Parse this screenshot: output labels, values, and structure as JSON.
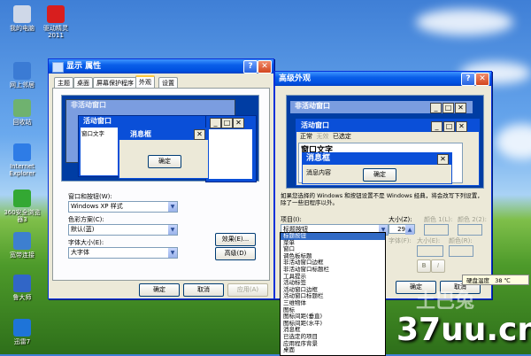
{
  "desktop_icons": [
    {
      "label": "我的电脑",
      "color": "#cfd8e8"
    },
    {
      "label": "驱动精灵\n2011",
      "color": "#d81e1e"
    },
    {
      "label": "网上邻居",
      "color": "#3b7bd4"
    },
    {
      "label": "回收站",
      "color": "#6fb26f"
    },
    {
      "label": "Internet\nExplorer",
      "color": "#2e7ce6"
    },
    {
      "label": "360安全浏览\n器3",
      "color": "#33a833"
    },
    {
      "label": "宽带连接",
      "color": "#3d7fd0"
    },
    {
      "label": "鲁大师",
      "color": "#3166c7"
    },
    {
      "label": "迅雷7",
      "color": "#1e74d8"
    }
  ],
  "display_window": {
    "title": "显示 属性",
    "tabs": [
      "主题",
      "桌面",
      "屏幕保护程序",
      "外观",
      "设置"
    ],
    "active_tab": 3,
    "preview": {
      "inactive_title": "非活动窗口",
      "active_title": "活动窗口",
      "window_text": "窗口文字",
      "msgbox_title": "消息框",
      "ok_label": "确定"
    },
    "style_label": "窗口和按钮(W):",
    "style_value": "Windows XP 样式",
    "color_label": "色彩方案(C):",
    "color_value": "默认(蓝)",
    "font_label": "字体大小(E):",
    "font_value": "大字体",
    "effects_button": "效果(E)...",
    "advanced_button": "高级(D)",
    "ok_button": "确定",
    "cancel_button": "取消",
    "apply_button": "应用(A)"
  },
  "advanced_window": {
    "title": "高级外观",
    "preview": {
      "inactive_title": "非活动窗口",
      "active_title": "活动窗口",
      "menu_items": [
        "正常",
        "无效",
        "已选定"
      ],
      "window_text": "窗口文字",
      "msgbox_title": "消息框",
      "msg_content": "消息内容",
      "ok_label": "确定"
    },
    "description": "如果您选择的 Windows 和按钮设置不是 Windows 经典，将会改写下列设置，除了一些旧程序以外。",
    "item_label": "项目(I):",
    "item_value": "标题按钮",
    "size_label": "大小(Z):",
    "size_value": "29",
    "color1_label": "颜色 1(L):",
    "color2_label": "颜色 2(2):",
    "font_label": "字体(F):",
    "font_size_label": "大小(E):",
    "font_color_label": "颜色(R):",
    "list_items": [
      "标题按钮",
      "菜单",
      "窗口",
      "调色板标题",
      "非活动窗口边框",
      "非活动窗口标题栏",
      "工具提示",
      "活动标签",
      "活动窗口边框",
      "活动窗口标题栏",
      "三维物体",
      "图标",
      "图标间距(垂直)",
      "图标间距(水平)",
      "消息框",
      "已选定的项目",
      "应用程序背景",
      "桌面"
    ],
    "selected_index": 0,
    "ok_button": "确定",
    "cancel_button": "取消"
  },
  "taskbar_tip": {
    "label": "硬盘温度",
    "value": "38 ℃"
  },
  "watermark": {
    "text": "37uu.cn",
    "logo_text": "土巴兔"
  }
}
